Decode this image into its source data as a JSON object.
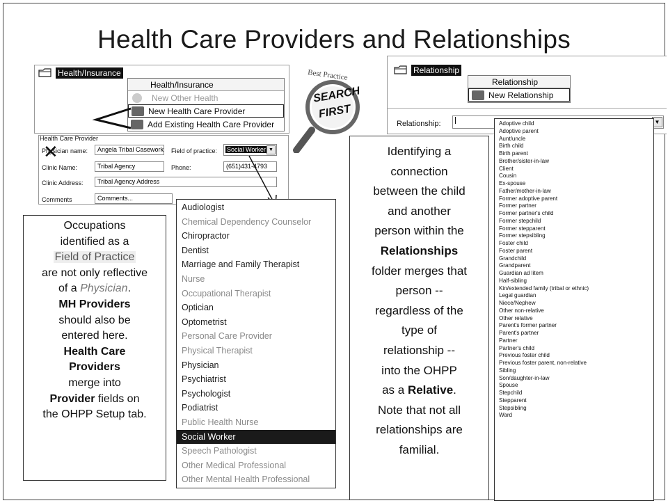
{
  "title": "Health Care Providers and Relationships",
  "health": {
    "tree_label": "Health/Insurance",
    "menu_header": "Health/Insurance",
    "menu_items": [
      {
        "label": "New Other Health",
        "disabled": true
      },
      {
        "label": "New Health Care Provider",
        "disabled": false
      },
      {
        "label": "Add Existing Health Care Provider",
        "disabled": false
      }
    ]
  },
  "badge": {
    "arc_text": "Best Practice",
    "line1": "SEARCH",
    "line2": "FIRST"
  },
  "form": {
    "group_label": "Health Care Provider",
    "physician_label": "Physician name:",
    "physician_value": "Angela Tribal Caseworker",
    "field_label": "Field of practice:",
    "field_value": "Social Worker",
    "clinic_label": "Clinic Name:",
    "clinic_value": "Tribal Agency",
    "phone_label": "Phone:",
    "phone_value": "(651)431-4793",
    "address_label": "Clinic Address:",
    "address_value": "Tribal Agency Address",
    "comments_label": "Comments",
    "comments_value": "Comments..."
  },
  "practice_list": [
    {
      "label": "Audiologist",
      "faded": false
    },
    {
      "label": "Chemical Dependency Counselor",
      "faded": true
    },
    {
      "label": "Chiropractor",
      "faded": false
    },
    {
      "label": "Dentist",
      "faded": false
    },
    {
      "label": "Marriage and Family Therapist",
      "faded": false
    },
    {
      "label": "Nurse",
      "faded": true
    },
    {
      "label": "Occupational Therapist",
      "faded": true
    },
    {
      "label": "Optician",
      "faded": false
    },
    {
      "label": "Optometrist",
      "faded": false
    },
    {
      "label": "Personal Care Provider",
      "faded": true
    },
    {
      "label": "Physical Therapist",
      "faded": true
    },
    {
      "label": "Physician",
      "faded": false
    },
    {
      "label": "Psychiatrist",
      "faded": false
    },
    {
      "label": "Psychologist",
      "faded": false
    },
    {
      "label": "Podiatrist",
      "faded": false
    },
    {
      "label": "Public Health Nurse",
      "faded": true
    },
    {
      "label": "Social Worker",
      "faded": false,
      "selected": true
    },
    {
      "label": "Speech Pathologist",
      "faded": true
    },
    {
      "label": "Other Medical Professional",
      "faded": true
    },
    {
      "label": "Other Mental Health Professional",
      "faded": true
    }
  ],
  "left_note": {
    "l1": "Occupations",
    "l2": "identified as a",
    "l3": "Field of Practice",
    "l4a": "are not only reflective",
    "l5a": "of a ",
    "l5b": "Physician",
    "l5c": ".",
    "l6": "MH Providers",
    "l7": "should also be",
    "l8": "entered here.",
    "l9": "Health Care",
    "l10": "Providers",
    "l11": "merge into",
    "l12a": "Provider",
    "l12b": " fields on",
    "l13": "the OHPP Setup tab."
  },
  "relationship": {
    "tree_label": "Relationship",
    "menu_header": "Relationship",
    "menu_item": "New Relationship",
    "field_label": "Relationship:",
    "field_value": ""
  },
  "relationship_list": [
    "Adoptive child",
    "Adoptive parent",
    "Aunt/uncle",
    "Birth child",
    "Birth parent",
    "Brother/sister-in-law",
    "Client",
    "Cousin",
    "Ex-spouse",
    "Father/mother-in-law",
    "Former adoptive parent",
    "Former partner",
    "Former partner's child",
    "Former stepchild",
    "Former stepparent",
    "Former stepsibling",
    "Foster child",
    "Foster parent",
    "Grandchild",
    "Grandparent",
    "Guardian ad litem",
    "Half-sibling",
    "Kin/extended family (tribal or ethnic)",
    "Legal guardian",
    "Niece/Nephew",
    "Other non-relative",
    "Other relative",
    "Parent's former partner",
    "Parent's partner",
    "Partner",
    "Partner's child",
    "Previous foster child",
    "Previous foster parent, non-relative",
    "Sibling",
    "Son/daughter-in-law",
    "Spouse",
    "Stepchild",
    "Stepparent",
    "Stepsibling",
    "Ward"
  ],
  "right_note": {
    "l1": "Identifying a",
    "l2": "connection",
    "l3": "between the child",
    "l4": "and another",
    "l5": "person within the",
    "l6": "Relationships",
    "l7": "folder merges that",
    "l8": "person --",
    "l9": "regardless of the",
    "l10": "type of",
    "l11": "relationship --",
    "l12": "into the OHPP",
    "l13a": "as a ",
    "l13b": "Relative",
    "l13c": ".",
    "l14": "Note that not all",
    "l15": "relationships are",
    "l16": "familial."
  },
  "colors": {
    "selected_bg": "#1a1a1a",
    "faded_text": "#8a8a8a",
    "badge_orange": "#e08a3a"
  }
}
